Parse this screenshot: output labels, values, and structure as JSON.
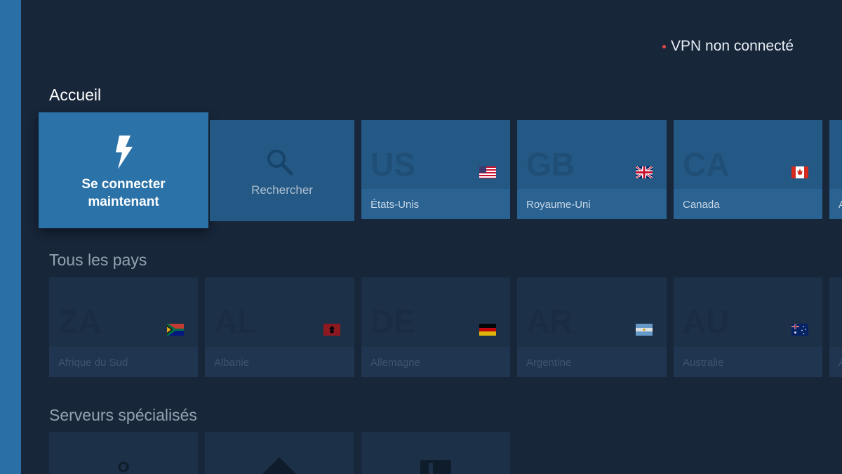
{
  "status": {
    "text": "VPN non connecté",
    "dot_color": "#e04848"
  },
  "sections": {
    "home": "Accueil",
    "all_countries": "Tous les pays",
    "specialized": "Serveurs spécialisés"
  },
  "connect": {
    "line1": "Se connecter",
    "line2": "maintenant",
    "icon": "lightning-bolt-icon"
  },
  "search": {
    "label": "Rechercher",
    "icon": "search-icon"
  },
  "home_countries": [
    {
      "code": "US",
      "name": "États-Unis",
      "flag": "us-flag-icon"
    },
    {
      "code": "GB",
      "name": "Royaume-Uni",
      "flag": "gb-flag-icon"
    },
    {
      "code": "CA",
      "name": "Canada",
      "flag": "ca-flag-icon"
    },
    {
      "code": "",
      "name": "A",
      "flag": ""
    }
  ],
  "countries": [
    {
      "code": "ZA",
      "name": "Afrique du Sud",
      "flag": "za-flag-icon"
    },
    {
      "code": "AL",
      "name": "Albanie",
      "flag": "al-flag-icon"
    },
    {
      "code": "DE",
      "name": "Allemagne",
      "flag": "de-flag-icon"
    },
    {
      "code": "AR",
      "name": "Argentine",
      "flag": "ar-flag-icon"
    },
    {
      "code": "AU",
      "name": "Australie",
      "flag": "au-flag-icon"
    },
    {
      "code": "",
      "name": "A",
      "flag": ""
    }
  ],
  "colors": {
    "accent": "#2b72a8",
    "background": "#18263a",
    "rail": "#2a6fa5"
  }
}
